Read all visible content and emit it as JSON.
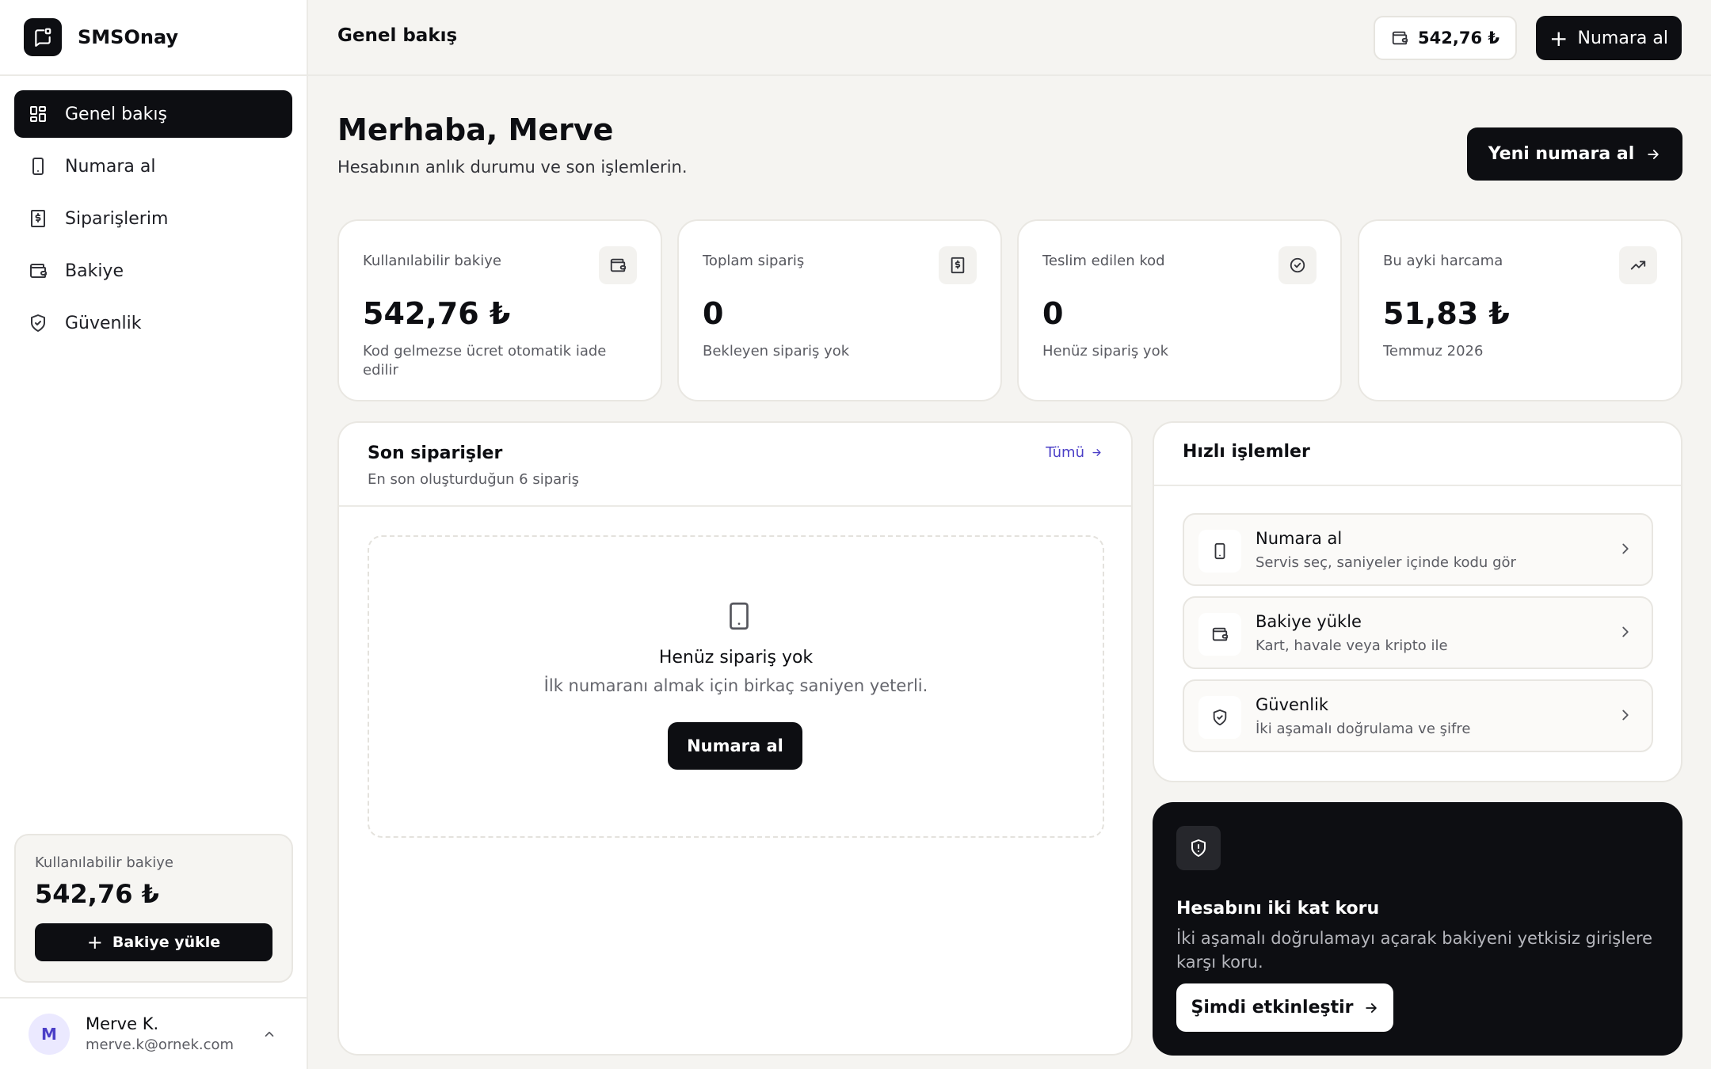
{
  "brand": {
    "name": "SMSOnay"
  },
  "sidebar": {
    "items": [
      {
        "label": "Genel bakış",
        "icon": "grid-icon",
        "active": true
      },
      {
        "label": "Numara al",
        "icon": "phone-icon",
        "active": false
      },
      {
        "label": "Siparişlerim",
        "icon": "receipt-icon",
        "active": false
      },
      {
        "label": "Bakiye",
        "icon": "wallet-icon",
        "active": false
      },
      {
        "label": "Güvenlik",
        "icon": "shield-check-icon",
        "active": false
      }
    ],
    "balance": {
      "label": "Kullanılabilir bakiye",
      "amount": "542,76 ₺",
      "button": "Bakiye yükle"
    },
    "user": {
      "initial": "M",
      "name": "Merve K.",
      "email": "merve.k@ornek.com"
    }
  },
  "topbar": {
    "title": "Genel bakış",
    "balance": "542,76 ₺",
    "button": "Numara al"
  },
  "greeting": {
    "title": "Merhaba, Merve",
    "subtitle": "Hesabının anlık durumu ve son işlemlerin.",
    "button": "Yeni numara al"
  },
  "stats": [
    {
      "label": "Kullanılabilir bakiye",
      "value": "542,76 ₺",
      "note": "Kod gelmezse ücret otomatik iade edilir",
      "icon": "wallet-icon"
    },
    {
      "label": "Toplam sipariş",
      "value": "0",
      "note": "Bekleyen sipariş yok",
      "icon": "receipt-icon"
    },
    {
      "label": "Teslim edilen kod",
      "value": "0",
      "note": "Henüz sipariş yok",
      "icon": "check-circle-icon"
    },
    {
      "label": "Bu ayki harcama",
      "value": "51,83 ₺",
      "note": "Temmuz 2026",
      "icon": "trending-up-icon"
    }
  ],
  "orders": {
    "title": "Son siparişler",
    "subtitle": "En son oluşturduğun 6 sipariş",
    "all_link": "Tümü",
    "empty_title": "Henüz sipariş yok",
    "empty_text": "İlk numaranı almak için birkaç saniyen yeterli.",
    "empty_button": "Numara al"
  },
  "quick": {
    "title": "Hızlı işlemler",
    "items": [
      {
        "title": "Numara al",
        "subtitle": "Servis seç, saniyeler içinde kodu gör",
        "icon": "phone-icon"
      },
      {
        "title": "Bakiye yükle",
        "subtitle": "Kart, havale veya kripto ile",
        "icon": "wallet-icon"
      },
      {
        "title": "Güvenlik",
        "subtitle": "İki aşamalı doğrulama ve şifre",
        "icon": "shield-check-icon"
      }
    ]
  },
  "promo": {
    "title": "Hesabını iki kat koru",
    "text": "İki aşamalı doğrulamayı açarak bakiyeni yetkisiz girişlere karşı koru.",
    "button": "Şimdi etkinleştir"
  }
}
